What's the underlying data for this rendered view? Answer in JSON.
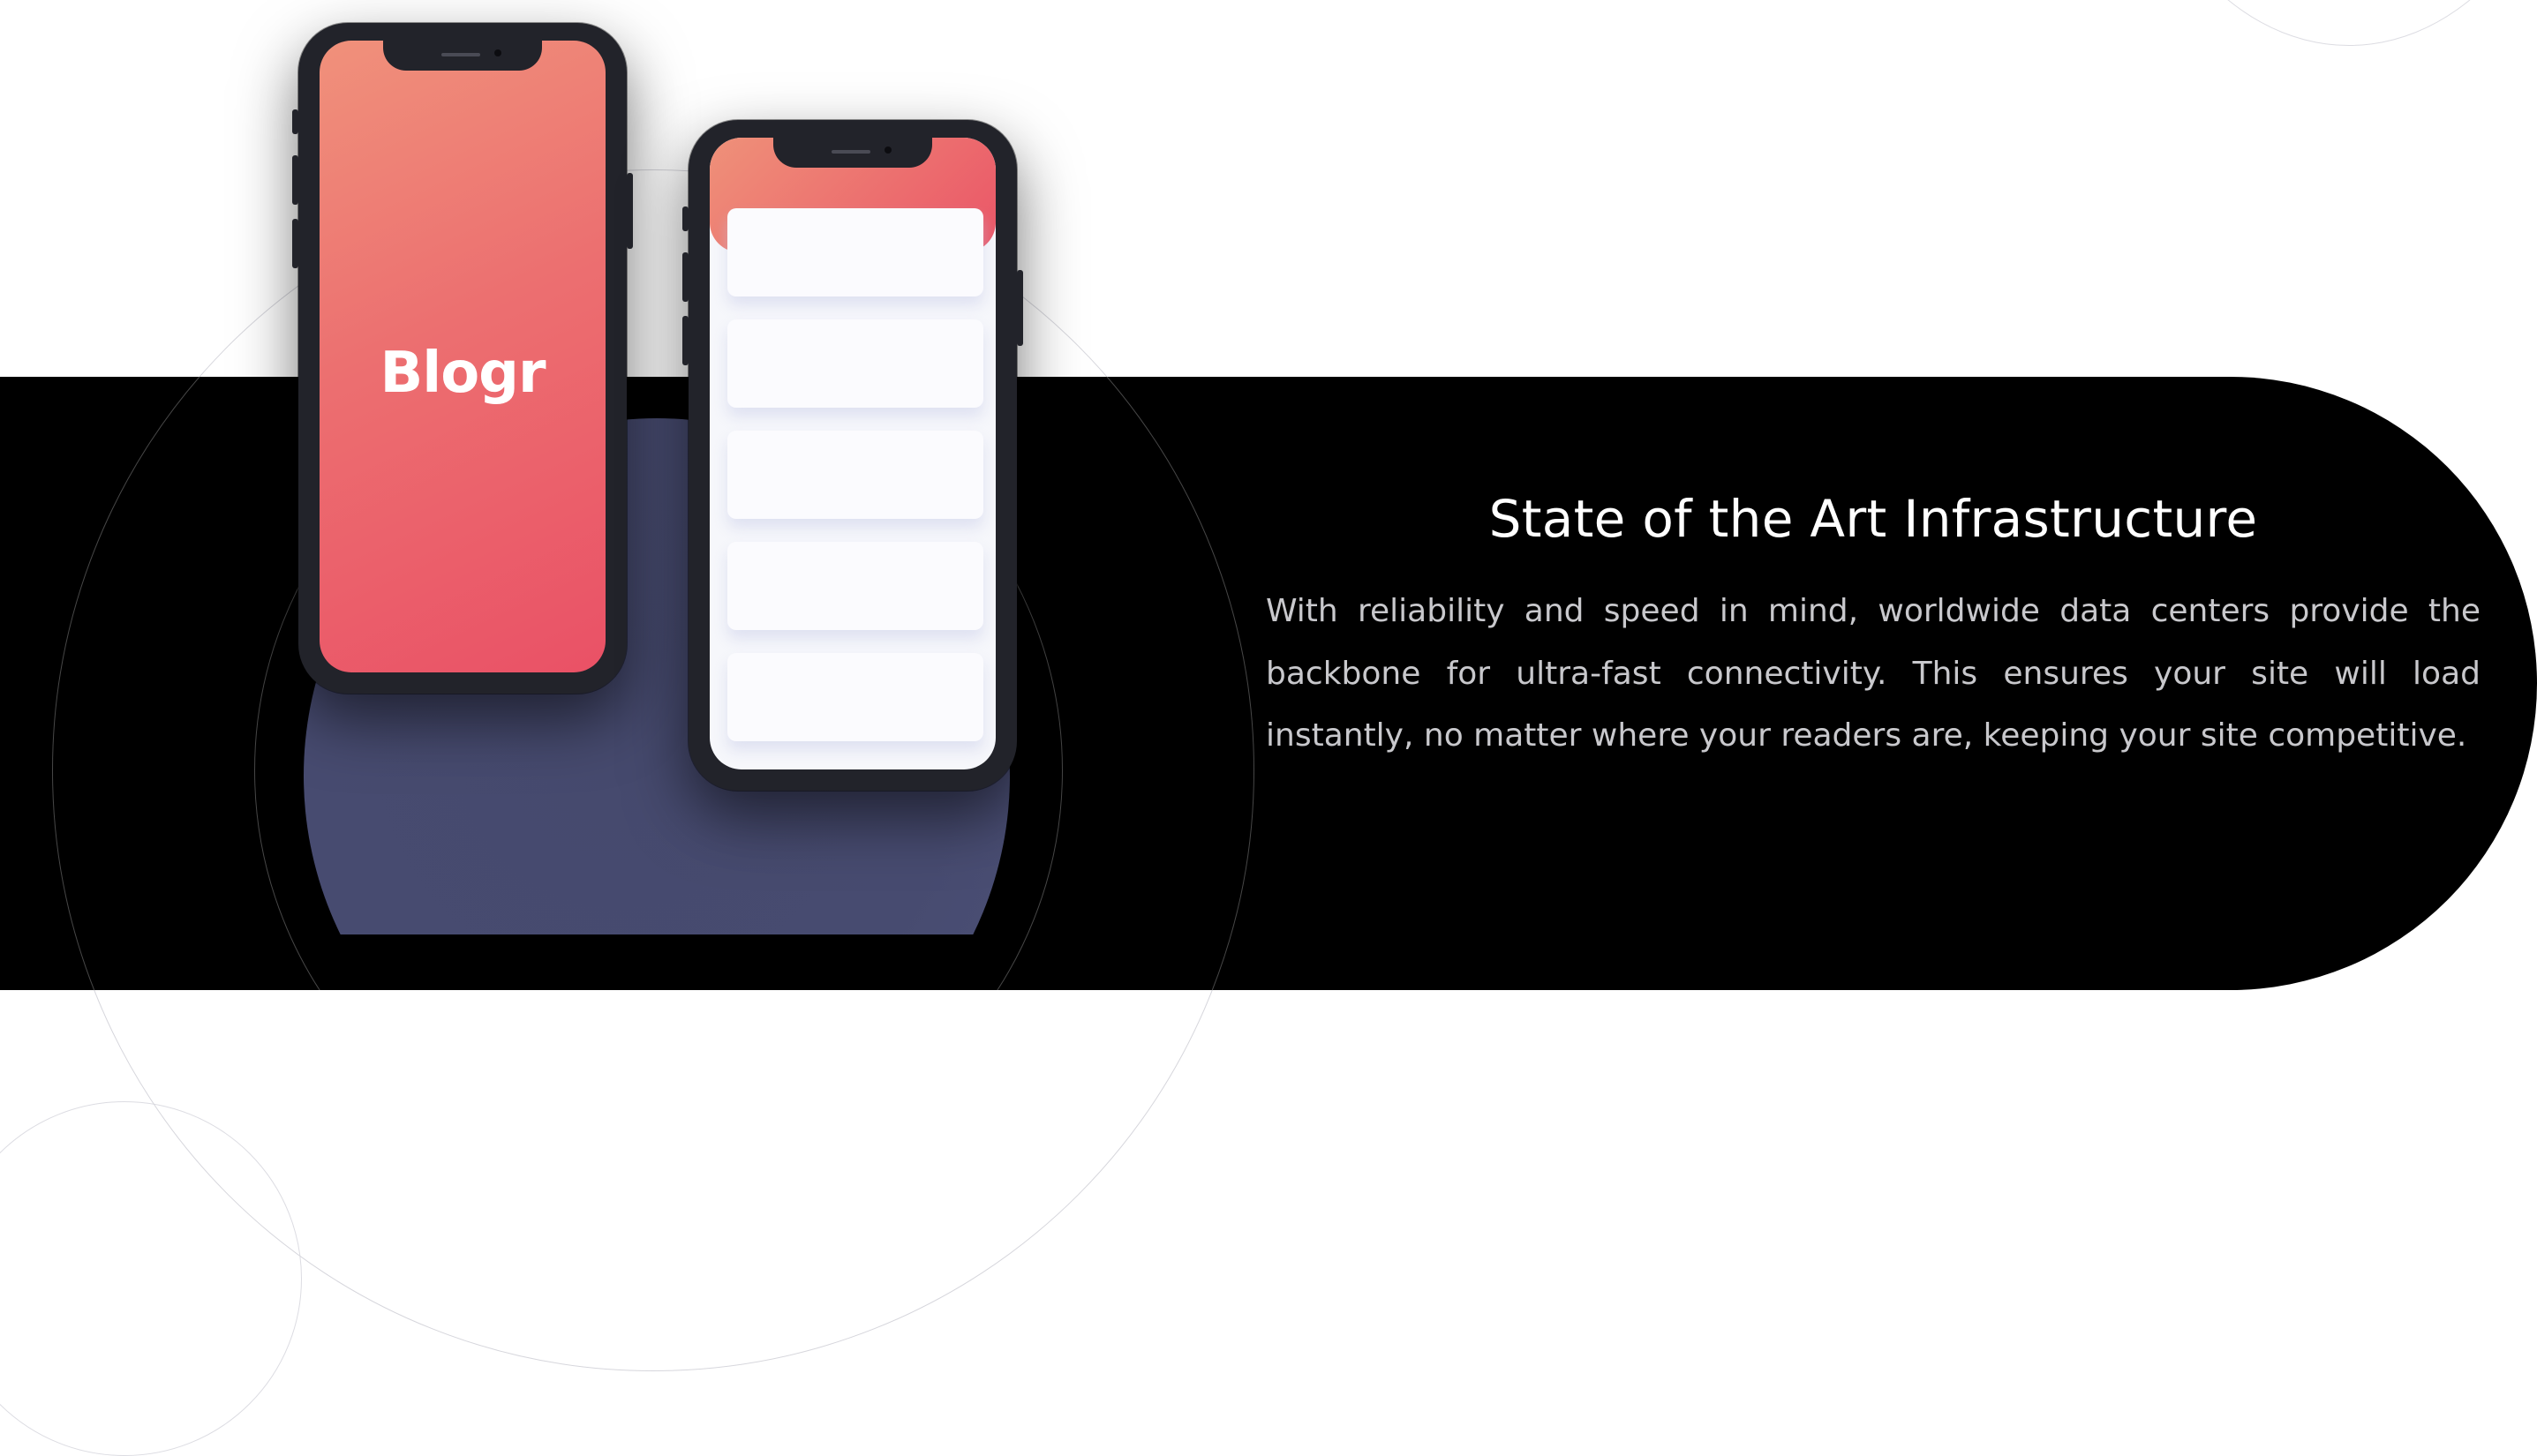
{
  "feature": {
    "heading": "State of the Art Infrastructure",
    "body": "With reliability and speed in mind, worldwide data centers provide the backbone for ultra-fast connectivity. This ensures your site will load instantly, no matter where your readers are, keeping your site competitive."
  },
  "phone_left": {
    "brand": "Blogr",
    "screen_gradient": [
      "#f0907a",
      "#ea5166"
    ]
  },
  "phone_right": {
    "card_count": 5
  },
  "colors": {
    "band": "#000000",
    "disc": "#474b70",
    "heading": "#ffffff",
    "body_text": "#c8c8cc",
    "phone_frame": "#22232a"
  }
}
